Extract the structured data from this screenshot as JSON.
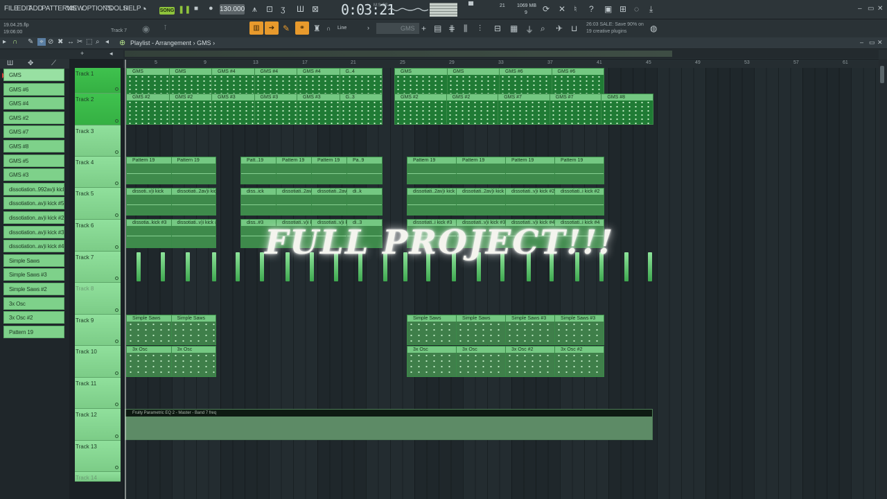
{
  "menu": [
    "FILE",
    "EDIT",
    "ADD",
    "PATTERNS",
    "VIEW",
    "OPTIONS",
    "TOOLS",
    "HELP"
  ],
  "transport": {
    "mode": "SONG",
    "tempo": "130.000",
    "time": "0:03:21",
    "time_sub": "M:S:CS"
  },
  "perf": {
    "memory": "1069 MB",
    "cpu_top": "21",
    "cpu_bottom": "9"
  },
  "file": {
    "name": "19.04.25.flp",
    "time": "19:06:00"
  },
  "hint_track": "Track 7",
  "snap": "Line",
  "pattern_selector": "GMS",
  "news": {
    "line1": "26:03 SALE: Save 90% on",
    "line2": "19 creative plugins"
  },
  "playlist": {
    "title": "Playlist - Arrangement",
    "pattern": "GMS"
  },
  "picker": [
    "GMS",
    "GMS #6",
    "GMS #4",
    "GMS #2",
    "GMS #7",
    "GMS #8",
    "GMS #5",
    "GMS #3",
    "dissotiation..992av)i kick",
    "dissotiation..av)i kick #5",
    "dissotiation..av)i kick #2",
    "dissotiation..av)i kick #3",
    "dissotiation..av)i kick #4",
    "Simple Saws",
    "Simple Saws #3",
    "Simple Saws #2",
    "3x Osc",
    "3x Osc #2",
    "Pattern 19"
  ],
  "tracks": [
    "Track 1",
    "Track 2",
    "Track 3",
    "Track 4",
    "Track 5",
    "Track 6",
    "Track 7",
    "Track 8",
    "Track 9",
    "Track 10",
    "Track 11",
    "Track 12",
    "Track 13",
    "Track 14"
  ],
  "bar_numbers": [
    "5",
    "9",
    "13",
    "17",
    "21",
    "25",
    "29",
    "33",
    "37",
    "41",
    "45",
    "49",
    "53",
    "57",
    "61"
  ],
  "clips": {
    "t1a": [
      "GMS",
      "GMS",
      "GMS #4",
      "GMS #4",
      "GMS #4",
      "G..4"
    ],
    "t1b": [
      "GMS",
      "GMS",
      "GMS #6",
      "GMS #6"
    ],
    "t2a": [
      "GMS #2",
      "GMS #2",
      "GMS #3",
      "GMS #3",
      "GMS #3",
      "G..3"
    ],
    "t2b": [
      "GMS #2",
      "GMS #2",
      "GMS #7",
      "GMS #7",
      "GMS #8"
    ],
    "t4a": [
      "Pattern 19",
      "Pattern 19"
    ],
    "t4b": [
      "Patt..19",
      "Pattern 19",
      "Pattern 19",
      "Pa..9"
    ],
    "t4c": [
      "Pattern 19",
      "Pattern 19",
      "Pattern 19",
      "Pattern 19"
    ],
    "t5a": [
      "dissoti..v)i kick",
      "dissotiati..2av)i kick"
    ],
    "t5b": [
      "diss..ick",
      "dissotiati..2av)i kick",
      "dissotiati..2av)i kick",
      "di..k"
    ],
    "t5c": [
      "dissotiati..2av)i kick",
      "dissotiati..2av)i kick",
      "dissotiati..v)i kick #2",
      "dissotiati..i kick #2"
    ],
    "t6a": [
      "dissotia..kick #3",
      "dissotiati..v)i kick #3"
    ],
    "t6b": [
      "diss..#3",
      "dissotiati..v)i kick #3",
      "dissotiati..v)i kick #3",
      "di..3"
    ],
    "t6c": [
      "dissotiati..i kick #3",
      "dissotiati..v)i kick #3",
      "dissotiati..v)i kick #4",
      "dissotiati..i kick #4"
    ],
    "t9a": [
      "Simple Saws",
      "Simple Saws"
    ],
    "t9b": [
      "Simple Saws",
      "Simple Saws",
      "Simple Saws #3",
      "Simple Saws #3"
    ],
    "t10a": [
      "3x Osc",
      "3x Osc"
    ],
    "t10b": [
      "3x Osc",
      "3x Osc",
      "3x Osc #2",
      "3x Osc #2"
    ]
  },
  "automation_label": "Fruity Parametric EQ 2 - Master - Band 7 freq",
  "overlay_title": "FULL PROJECT!!!",
  "colors": {
    "clip_green": "#74c882",
    "track_active": "#3fc24e",
    "accent_orange": "#e89a2c",
    "song_green": "#8fc43c"
  }
}
